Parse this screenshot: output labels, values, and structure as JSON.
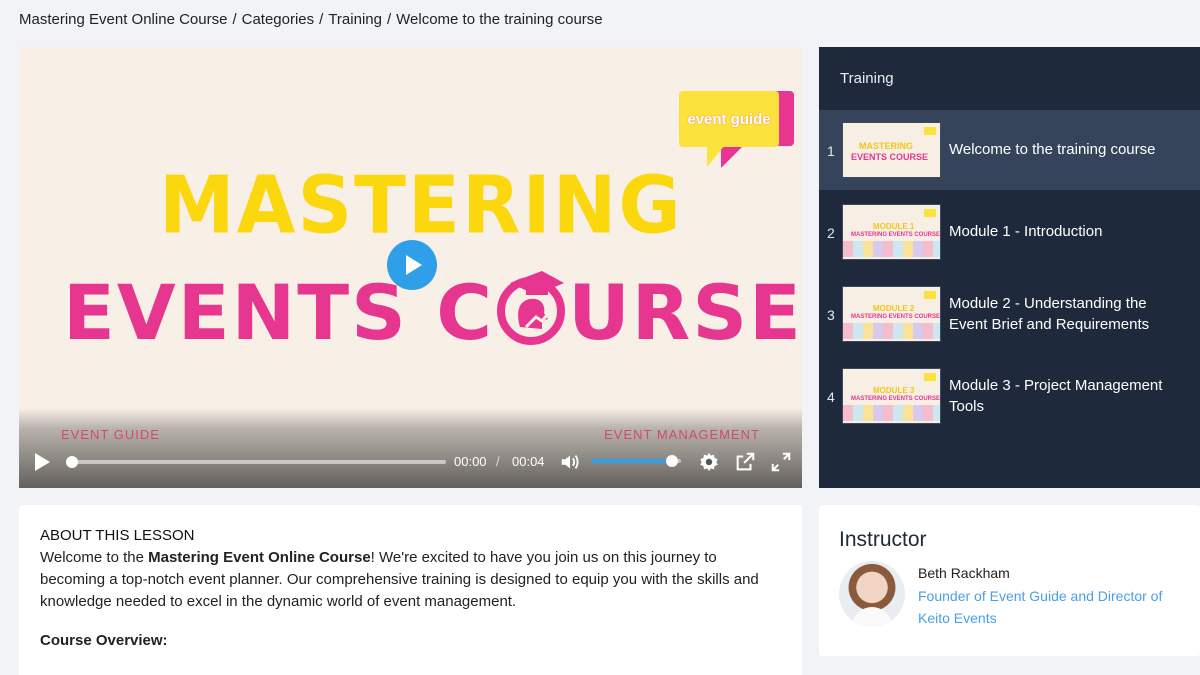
{
  "breadcrumb": {
    "items": [
      "Mastering Event Online Course",
      "Categories",
      "Training",
      "Welcome to the training course"
    ],
    "separator": "/"
  },
  "video": {
    "badge_text": "event guide",
    "title_line1": "MASTERING",
    "title_line2_a": "EVENTS C",
    "title_line2_b": "URSE",
    "footer_left": "EVENT GUIDE",
    "footer_right": "EVENT MANAGEMENT",
    "current_time": "00:00",
    "time_separator": "/",
    "duration": "00:04",
    "progress": 0.0,
    "volume": 0.9,
    "colors": {
      "yellow": "#fbd80e",
      "pink": "#e7368f",
      "play_blue": "#2f9fea"
    }
  },
  "sidebar": {
    "title": "Training",
    "lessons": [
      {
        "num": "1",
        "title": "Welcome to the training course",
        "thumb_line1": "MASTERING",
        "thumb_line2": "EVENTS COURSE",
        "active": true
      },
      {
        "num": "2",
        "title": "Module 1 - Introduction",
        "thumb_line1": "MODULE 1",
        "thumb_line2": "MASTERING EVENTS COURSE",
        "active": false
      },
      {
        "num": "3",
        "title": "Module 2 - Understanding the Event Brief and Requirements",
        "thumb_line1": "MODULE 2",
        "thumb_line2": "MASTERING EVENTS COURSE",
        "active": false
      },
      {
        "num": "4",
        "title": "Module 3 - Project Management Tools",
        "thumb_line1": "MODULE 3",
        "thumb_line2": "MASTERING EVENTS COURSE",
        "active": false
      }
    ]
  },
  "about": {
    "heading": "ABOUT THIS LESSON",
    "text_before": "Welcome to the ",
    "text_bold": "Mastering Event Online Course",
    "text_after": "! We're excited to have you join us on this journey to becoming a top-notch event planner. Our comprehensive training is designed to equip you with the skills and knowledge needed to excel in the dynamic world of event management.",
    "overview_heading": "Course Overview:"
  },
  "instructor": {
    "title": "Instructor",
    "name": "Beth Rackham",
    "role": "Founder of Event Guide and Director of Keito Events"
  }
}
